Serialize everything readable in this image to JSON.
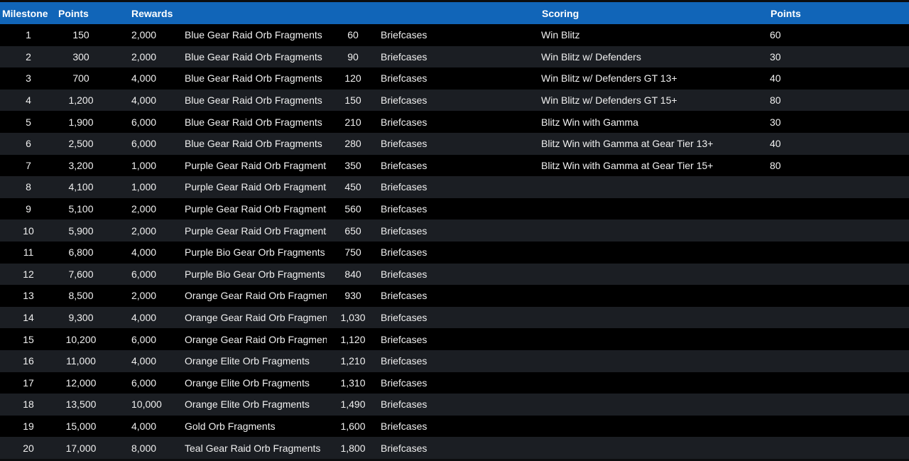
{
  "header": {
    "milestone": "Milestone",
    "points": "Points",
    "rewards": "Rewards",
    "scoring": "Scoring",
    "scoring_points": "Points"
  },
  "rows": [
    {
      "milestone": "1",
      "points": "150",
      "rewards": "2,000",
      "fragment": "Blue Gear Raid Orb Fragments",
      "qty": "60",
      "qty_item": "Briefcases",
      "scoring": "Win Blitz",
      "scoring_points": "60"
    },
    {
      "milestone": "2",
      "points": "300",
      "rewards": "2,000",
      "fragment": "Blue Gear Raid Orb Fragments",
      "qty": "90",
      "qty_item": "Briefcases",
      "scoring": "Win Blitz w/ Defenders",
      "scoring_points": "30"
    },
    {
      "milestone": "3",
      "points": "700",
      "rewards": "4,000",
      "fragment": "Blue Gear Raid Orb Fragments",
      "qty": "120",
      "qty_item": "Briefcases",
      "scoring": "Win Blitz w/ Defenders GT 13+",
      "scoring_points": "40"
    },
    {
      "milestone": "4",
      "points": "1,200",
      "rewards": "4,000",
      "fragment": "Blue Gear Raid Orb Fragments",
      "qty": "150",
      "qty_item": "Briefcases",
      "scoring": "Win Blitz w/ Defenders GT 15+",
      "scoring_points": "80"
    },
    {
      "milestone": "5",
      "points": "1,900",
      "rewards": "6,000",
      "fragment": "Blue Gear Raid Orb Fragments",
      "qty": "210",
      "qty_item": "Briefcases",
      "scoring": "Blitz Win with Gamma",
      "scoring_points": "30"
    },
    {
      "milestone": "6",
      "points": "2,500",
      "rewards": "6,000",
      "fragment": "Blue Gear Raid Orb Fragments",
      "qty": "280",
      "qty_item": "Briefcases",
      "scoring": "Blitz Win with Gamma at Gear Tier 13+",
      "scoring_points": "40"
    },
    {
      "milestone": "7",
      "points": "3,200",
      "rewards": "1,000",
      "fragment": "Purple Gear Raid Orb Fragments",
      "qty": "350",
      "qty_item": "Briefcases",
      "scoring": "Blitz Win with Gamma at Gear Tier 15+",
      "scoring_points": "80"
    },
    {
      "milestone": "8",
      "points": "4,100",
      "rewards": "1,000",
      "fragment": "Purple Gear Raid Orb Fragments",
      "qty": "450",
      "qty_item": "Briefcases",
      "scoring": "",
      "scoring_points": ""
    },
    {
      "milestone": "9",
      "points": "5,100",
      "rewards": "2,000",
      "fragment": "Purple Gear Raid Orb Fragments",
      "qty": "560",
      "qty_item": "Briefcases",
      "scoring": "",
      "scoring_points": ""
    },
    {
      "milestone": "10",
      "points": "5,900",
      "rewards": "2,000",
      "fragment": "Purple Gear Raid Orb Fragments",
      "qty": "650",
      "qty_item": "Briefcases",
      "scoring": "",
      "scoring_points": ""
    },
    {
      "milestone": "11",
      "points": "6,800",
      "rewards": "4,000",
      "fragment": "Purple Bio Gear Orb Fragments",
      "qty": "750",
      "qty_item": "Briefcases",
      "scoring": "",
      "scoring_points": ""
    },
    {
      "milestone": "12",
      "points": "7,600",
      "rewards": "6,000",
      "fragment": "Purple Bio Gear Orb Fragments",
      "qty": "840",
      "qty_item": "Briefcases",
      "scoring": "",
      "scoring_points": ""
    },
    {
      "milestone": "13",
      "points": "8,500",
      "rewards": "2,000",
      "fragment": "Orange Gear Raid Orb Fragment",
      "qty": "930",
      "qty_item": "Briefcases",
      "scoring": "",
      "scoring_points": ""
    },
    {
      "milestone": "14",
      "points": "9,300",
      "rewards": "4,000",
      "fragment": "Orange Gear Raid Orb Fragment",
      "qty": "1,030",
      "qty_item": "Briefcases",
      "scoring": "",
      "scoring_points": ""
    },
    {
      "milestone": "15",
      "points": "10,200",
      "rewards": "6,000",
      "fragment": "Orange Gear Raid Orb Fragment",
      "qty": "1,120",
      "qty_item": "Briefcases",
      "scoring": "",
      "scoring_points": ""
    },
    {
      "milestone": "16",
      "points": "11,000",
      "rewards": "4,000",
      "fragment": "Orange Elite Orb Fragments",
      "qty": "1,210",
      "qty_item": "Briefcases",
      "scoring": "",
      "scoring_points": ""
    },
    {
      "milestone": "17",
      "points": "12,000",
      "rewards": "6,000",
      "fragment": "Orange Elite Orb Fragments",
      "qty": "1,310",
      "qty_item": "Briefcases",
      "scoring": "",
      "scoring_points": ""
    },
    {
      "milestone": "18",
      "points": "13,500",
      "rewards": "10,000",
      "fragment": "Orange Elite Orb Fragments",
      "qty": "1,490",
      "qty_item": "Briefcases",
      "scoring": "",
      "scoring_points": ""
    },
    {
      "milestone": "19",
      "points": "15,000",
      "rewards": "4,000",
      "fragment": "Gold Orb Fragments",
      "qty": "1,600",
      "qty_item": "Briefcases",
      "scoring": "",
      "scoring_points": ""
    },
    {
      "milestone": "20",
      "points": "17,000",
      "rewards": "8,000",
      "fragment": "Teal Gear Raid Orb Fragments",
      "qty": "1,800",
      "qty_item": "Briefcases",
      "scoring": "",
      "scoring_points": ""
    }
  ]
}
